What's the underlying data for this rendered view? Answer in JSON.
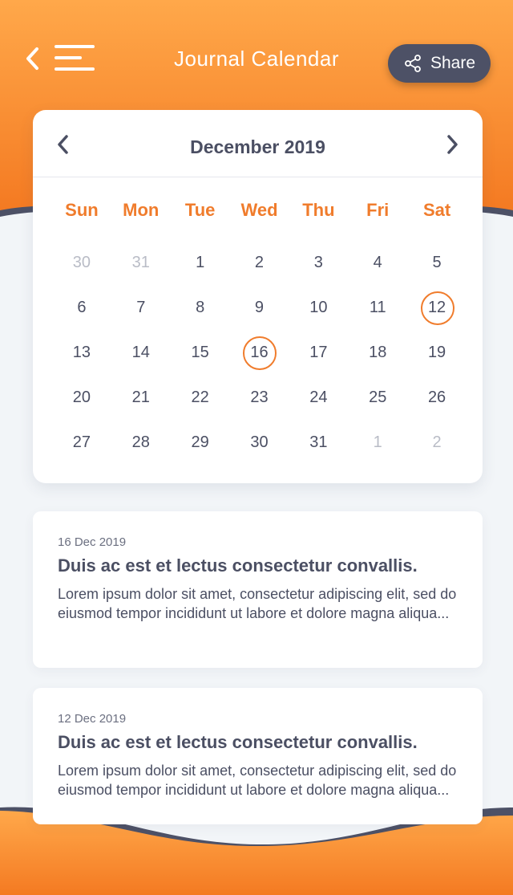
{
  "header": {
    "title": "Journal Calendar",
    "share_label": "Share",
    "back_icon": "chevron-left-icon",
    "menu_icon": "hamburger-menu-icon",
    "share_icon": "share-nodes-icon"
  },
  "calendar": {
    "month_label": "December 2019",
    "weekdays": [
      "Sun",
      "Mon",
      "Tue",
      "Wed",
      "Thu",
      "Fri",
      "Sat"
    ],
    "days": [
      {
        "label": "30",
        "muted": true,
        "marked": false
      },
      {
        "label": "31",
        "muted": true,
        "marked": false
      },
      {
        "label": "1",
        "muted": false,
        "marked": false
      },
      {
        "label": "2",
        "muted": false,
        "marked": false
      },
      {
        "label": "3",
        "muted": false,
        "marked": false
      },
      {
        "label": "4",
        "muted": false,
        "marked": false
      },
      {
        "label": "5",
        "muted": false,
        "marked": false
      },
      {
        "label": "6",
        "muted": false,
        "marked": false
      },
      {
        "label": "7",
        "muted": false,
        "marked": false
      },
      {
        "label": "8",
        "muted": false,
        "marked": false
      },
      {
        "label": "9",
        "muted": false,
        "marked": false
      },
      {
        "label": "10",
        "muted": false,
        "marked": false
      },
      {
        "label": "11",
        "muted": false,
        "marked": false
      },
      {
        "label": "12",
        "muted": false,
        "marked": true
      },
      {
        "label": "13",
        "muted": false,
        "marked": false
      },
      {
        "label": "14",
        "muted": false,
        "marked": false
      },
      {
        "label": "15",
        "muted": false,
        "marked": false
      },
      {
        "label": "16",
        "muted": false,
        "marked": true
      },
      {
        "label": "17",
        "muted": false,
        "marked": false
      },
      {
        "label": "18",
        "muted": false,
        "marked": false
      },
      {
        "label": "19",
        "muted": false,
        "marked": false
      },
      {
        "label": "20",
        "muted": false,
        "marked": false
      },
      {
        "label": "21",
        "muted": false,
        "marked": false
      },
      {
        "label": "22",
        "muted": false,
        "marked": false
      },
      {
        "label": "23",
        "muted": false,
        "marked": false
      },
      {
        "label": "24",
        "muted": false,
        "marked": false
      },
      {
        "label": "25",
        "muted": false,
        "marked": false
      },
      {
        "label": "26",
        "muted": false,
        "marked": false
      },
      {
        "label": "27",
        "muted": false,
        "marked": false
      },
      {
        "label": "28",
        "muted": false,
        "marked": false
      },
      {
        "label": "29",
        "muted": false,
        "marked": false
      },
      {
        "label": "30",
        "muted": false,
        "marked": false
      },
      {
        "label": "31",
        "muted": false,
        "marked": false
      },
      {
        "label": "1",
        "muted": true,
        "marked": false
      },
      {
        "label": "2",
        "muted": true,
        "marked": false
      }
    ]
  },
  "entries": [
    {
      "date": "16 Dec 2019",
      "title": "Duis ac est et lectus consectetur convallis.",
      "excerpt": "Lorem ipsum dolor sit amet, consectetur adipiscing elit, sed do eiusmod tempor incididunt ut labore et dolore magna aliqua..."
    },
    {
      "date": "12 Dec 2019",
      "title": "Duis ac est et lectus consectetur convallis.",
      "excerpt": "Lorem ipsum dolor sit amet, consectetur adipiscing elit, sed do eiusmod tempor incididunt ut labore et dolore magna aliqua..."
    }
  ],
  "colors": {
    "accent": "#f07c2c",
    "gradient_top": "#ffa84a",
    "gradient_bottom": "#f47a22",
    "dark": "#4d5166",
    "background": "#f2f5f8"
  }
}
